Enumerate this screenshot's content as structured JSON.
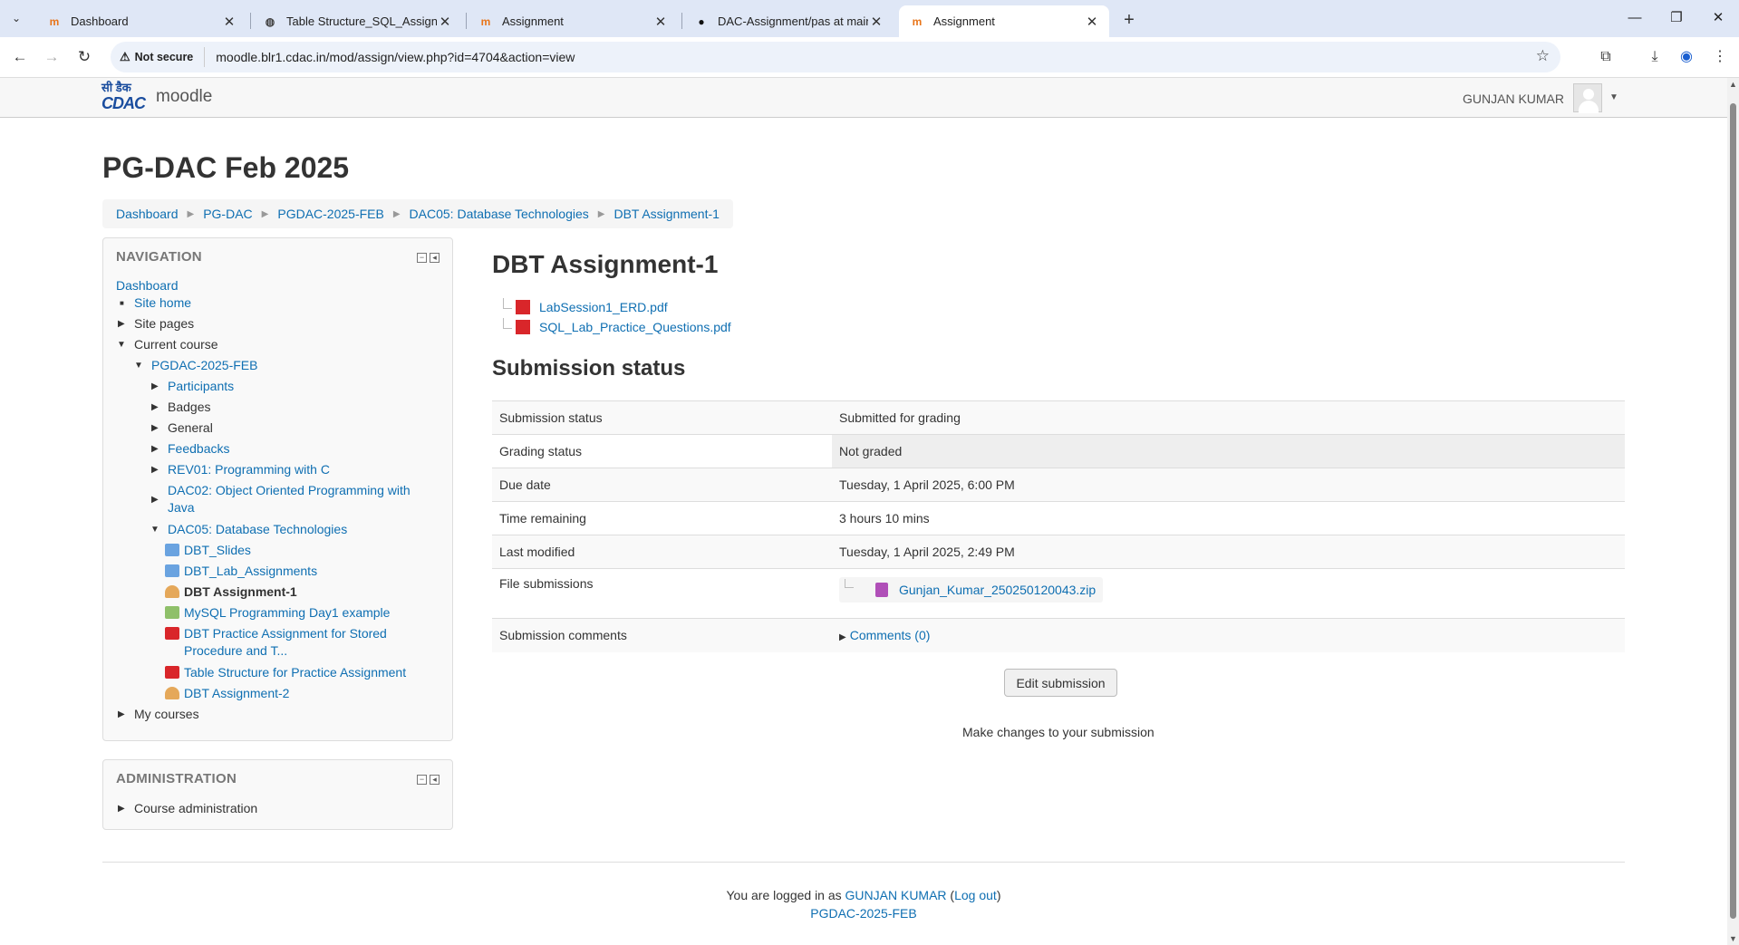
{
  "browser": {
    "tabs": [
      {
        "title": "Dashboard",
        "icon": "moodle-icon"
      },
      {
        "title": "Table Structure_SQL_Assignment",
        "icon": "globe-icon"
      },
      {
        "title": "Assignment",
        "icon": "moodle-icon"
      },
      {
        "title": "DAC-Assignment/pas at main · ",
        "icon": "github-icon"
      },
      {
        "title": "Assignment",
        "icon": "moodle-icon"
      }
    ],
    "not_secure": "Not secure",
    "url": "moodle.blr1.cdac.in/mod/assign/view.php?id=4704&action=view"
  },
  "header": {
    "logo_hindi": "सी डैक",
    "logo_text": "CDAC",
    "site_name": "moodle",
    "user_name": "GUNJAN KUMAR"
  },
  "page": {
    "title": "PG-DAC Feb 2025",
    "breadcrumb": [
      "Dashboard",
      "PG-DAC",
      "PGDAC-2025-FEB",
      "DAC05: Database Technologies",
      "DBT Assignment-1"
    ]
  },
  "navigation": {
    "title": "NAVIGATION",
    "items": {
      "dashboard": "Dashboard",
      "site_home": "Site home",
      "site_pages": "Site pages",
      "current_course": "Current course",
      "course": "PGDAC-2025-FEB",
      "participants": "Participants",
      "badges": "Badges",
      "general": "General",
      "feedbacks": "Feedbacks",
      "rev01": "REV01: Programming with C",
      "dac02_l1": "DAC02: Object Oriented Programming with",
      "dac02_l2": "Java",
      "dac05": "DAC05: Database Technologies",
      "dbt_slides": "DBT_Slides",
      "dbt_lab": "DBT_Lab_Assignments",
      "dbt_assign1": "DBT Assignment-1",
      "mysql_day1": "MySQL Programming Day1 example",
      "dbt_practice_l1": "DBT Practice Assignment for Stored",
      "dbt_practice_l2": "Procedure and T...",
      "table_structure": "Table Structure for Practice Assignment",
      "dbt_assign2": "DBT Assignment-2",
      "my_courses": "My courses"
    }
  },
  "administration": {
    "title": "ADMINISTRATION",
    "course_admin": "Course administration"
  },
  "main": {
    "title": "DBT Assignment-1",
    "files": [
      "LabSession1_ERD.pdf",
      "SQL_Lab_Practice_Questions.pdf"
    ],
    "submission_title": "Submission status",
    "rows": {
      "status_label": "Submission status",
      "status_value": "Submitted for grading",
      "grading_label": "Grading status",
      "grading_value": "Not graded",
      "due_label": "Due date",
      "due_value": "Tuesday, 1 April 2025, 6:00 PM",
      "remaining_label": "Time remaining",
      "remaining_value": "3 hours 10 mins",
      "modified_label": "Last modified",
      "modified_value": "Tuesday, 1 April 2025, 2:49 PM",
      "files_label": "File submissions",
      "files_value": "Gunjan_Kumar_250250120043.zip",
      "comments_label": "Submission comments",
      "comments_value": "Comments (0)"
    },
    "edit_button": "Edit submission",
    "edit_note": "Make changes to your submission"
  },
  "footer": {
    "logged_in_as": "You are logged in as ",
    "user": "GUNJAN KUMAR",
    "open_paren": " (",
    "logout": "Log out",
    "close_paren": ")",
    "course": "PGDAC-2025-FEB"
  }
}
